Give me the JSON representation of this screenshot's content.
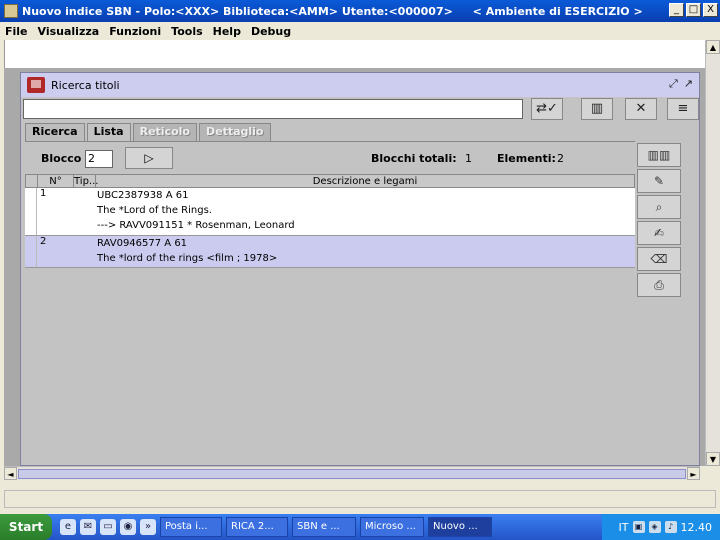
{
  "window": {
    "title_parts": [
      "Nuovo indice SBN - Polo:<XXX> Biblioteca:<AMM> Utente:<000007>",
      "< Ambiente di ESERCIZIO >"
    ],
    "controls": [
      "_",
      "□",
      "X"
    ]
  },
  "menu": [
    "File",
    "Visualizza",
    "Funzioni",
    "Tools",
    "Help",
    "Debug"
  ],
  "frame": {
    "title": "Ricerca titoli",
    "controls": [
      "⤢",
      "↗"
    ]
  },
  "toolbar": {
    "search_value": "",
    "buttons": [
      "confirm-icon",
      "library-icon",
      "cancel-icon",
      "list-icon"
    ]
  },
  "tabs": [
    {
      "label": "Ricerca",
      "state": "normal"
    },
    {
      "label": "Lista",
      "state": "active"
    },
    {
      "label": "Reticolo",
      "state": "disabled"
    },
    {
      "label": "Dettaglio",
      "state": "disabled"
    }
  ],
  "controls": {
    "blocco_label": "Blocco",
    "blocco_value": "2",
    "blocchi_totali_label": "Blocchi totali:",
    "blocchi_totali_value": "1",
    "elementi_label": "Elementi:",
    "elementi_value": "2"
  },
  "grid": {
    "headers": [
      "N°",
      "Tip...",
      "Descrizione e legami"
    ],
    "rows": [
      {
        "n": "1",
        "tip": "",
        "lines": [
          "UBC2387938 A 61",
          "The *Lord of the Rings.",
          "---> RAVV091151 * Rosenman, Leonard"
        ],
        "selected": false
      },
      {
        "n": "2",
        "tip": "",
        "lines": [
          "RAV0946577 A 61",
          "The *lord of the rings <film ; 1978>"
        ],
        "selected": true
      }
    ]
  },
  "side_buttons": [
    "books-icon",
    "edit-icon",
    "search-doc-icon",
    "notepad-icon",
    "eraser-icon",
    "print-icon"
  ],
  "taskbar": {
    "start": "Start",
    "items": [
      {
        "label": "Posta i...",
        "active": false
      },
      {
        "label": "RICA 2...",
        "active": false
      },
      {
        "label": "SBN e ...",
        "active": false
      },
      {
        "label": "Microso ...",
        "active": false
      },
      {
        "label": "Nuovo ...",
        "active": true
      }
    ],
    "lang": "IT",
    "time": "12.40"
  }
}
